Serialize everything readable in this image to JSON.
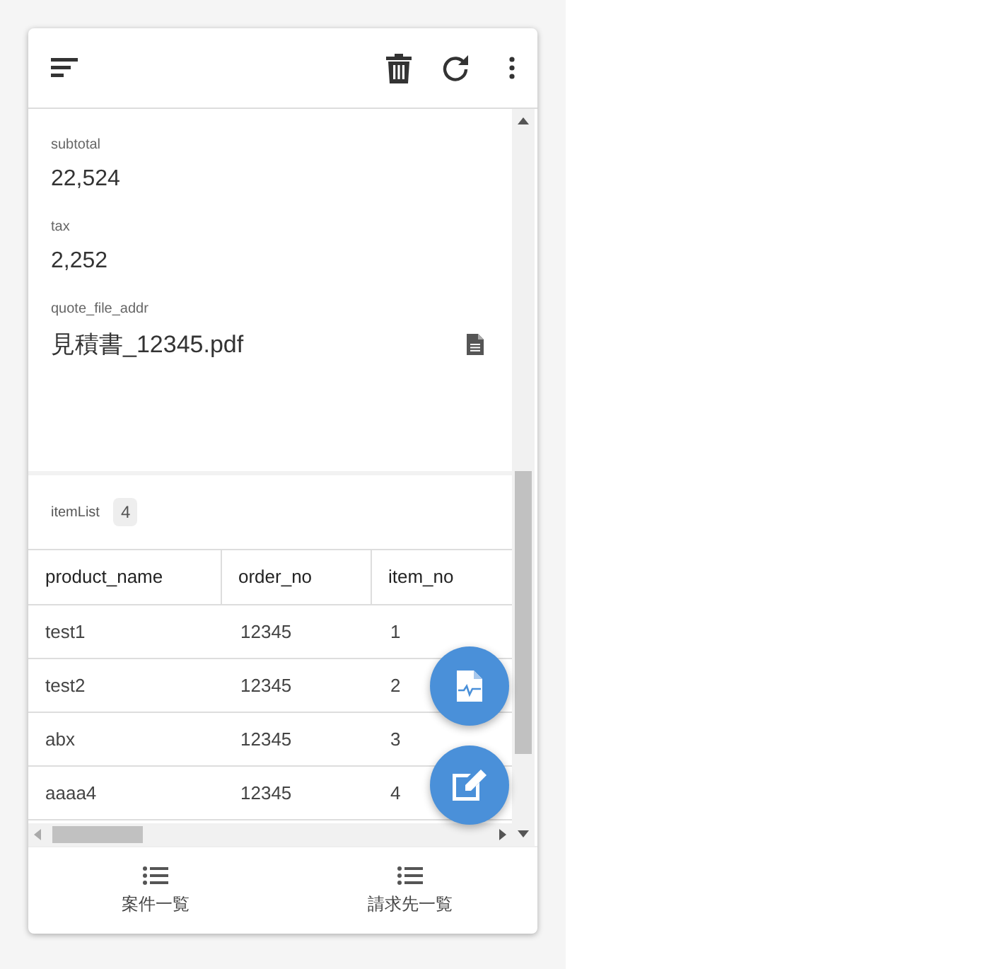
{
  "fields": [
    {
      "label": "subtotal",
      "value": "22,524"
    },
    {
      "label": "tax",
      "value": "2,252"
    },
    {
      "label": "quote_file_addr",
      "value": "見積書_12345.pdf",
      "kind": "file"
    }
  ],
  "item_list": {
    "label": "itemList",
    "count": "4"
  },
  "table": {
    "columns": [
      "product_name",
      "order_no",
      "item_no"
    ],
    "rows": [
      [
        "test1",
        "12345",
        "1"
      ],
      [
        "test2",
        "12345",
        "2"
      ],
      [
        "abx",
        "12345",
        "3"
      ],
      [
        "aaaa4",
        "12345",
        "4"
      ]
    ]
  },
  "bottom_nav": [
    {
      "label": "案件一覧"
    },
    {
      "label": "請求先一覧"
    }
  ]
}
